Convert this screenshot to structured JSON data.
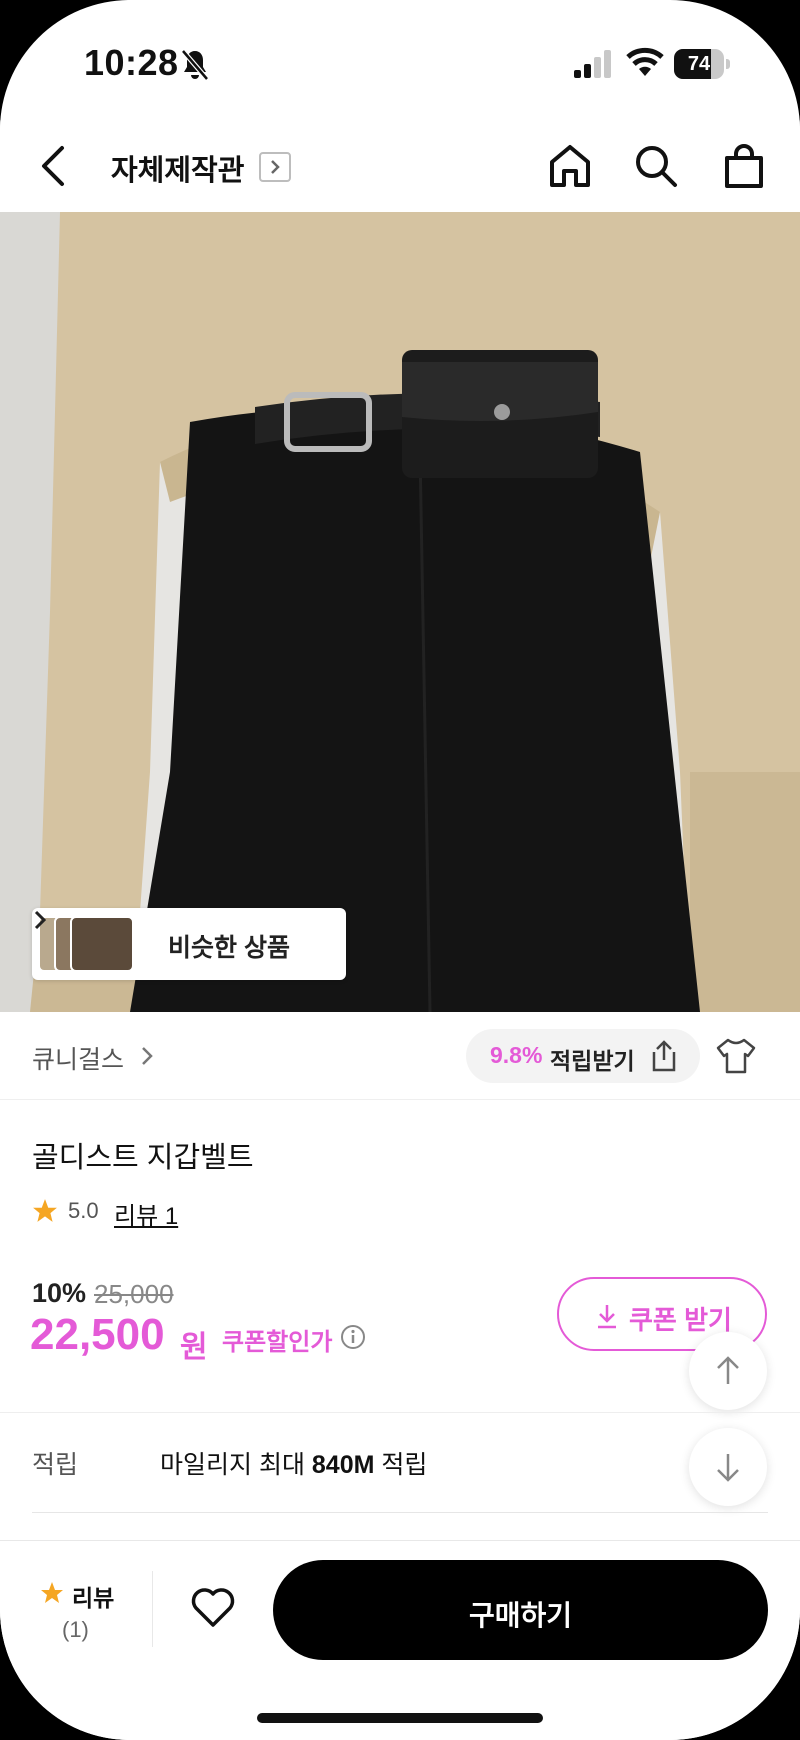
{
  "status_bar": {
    "time": "10:28",
    "battery": "74",
    "battery_level_pct": 74
  },
  "header": {
    "title": "자체제작관"
  },
  "hero": {
    "similar_label": "비슷한 상품"
  },
  "shop": {
    "name": "큐니걸스",
    "reward_pct": "9.8%",
    "reward_label": "적립받기"
  },
  "product": {
    "name": "골디스트 지갑벨트",
    "rating": "5.0",
    "review_link": "리뷰 1",
    "discount": "10%",
    "original_price": "25,000",
    "price": "22,500",
    "price_unit": "원",
    "coupon_price_label": "쿠폰할인가",
    "coupon_button": "쿠폰 받기"
  },
  "points": {
    "label": "적립",
    "text_prefix": "마일리지 최대 ",
    "amount": "840M",
    "text_suffix": " 적립"
  },
  "bottom": {
    "review_label": "리뷰",
    "review_count": "(1)",
    "buy_label": "구매하기"
  },
  "colors": {
    "accent": "#e45ad7",
    "star": "#f5a623",
    "buy_button": "#000000"
  },
  "icons": [
    "bell-slash-icon",
    "signal-icon",
    "wifi-icon",
    "battery-icon",
    "back-arrow-icon",
    "home-icon",
    "search-icon",
    "shopping-bag-icon",
    "share-icon",
    "fitting-icon",
    "star-icon",
    "info-icon",
    "download-icon",
    "arrow-up-icon",
    "arrow-down-icon",
    "heart-icon"
  ]
}
